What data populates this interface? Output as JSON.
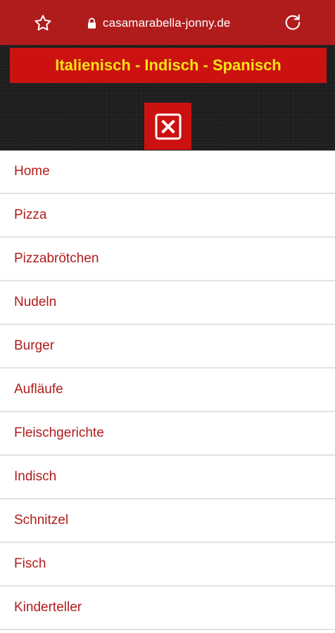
{
  "browser": {
    "url": "casamarabella-jonny.de",
    "icons": [
      "star-icon",
      "lock-icon",
      "reload-icon"
    ]
  },
  "header": {
    "banner_text": "Italienisch - Indisch - Spanisch",
    "close_icon": "close-icon"
  },
  "colors": {
    "brand_red": "#cc1111",
    "browser_red": "#b01c1c",
    "banner_text": "#f6e312",
    "menu_text": "#b01c1c",
    "dark_band": "#1f1f1f"
  },
  "menu": {
    "items": [
      {
        "label": "Home"
      },
      {
        "label": "Pizza"
      },
      {
        "label": "Pizzabrötchen"
      },
      {
        "label": "Nudeln"
      },
      {
        "label": "Burger"
      },
      {
        "label": "Aufläufe"
      },
      {
        "label": "Fleischgerichte"
      },
      {
        "label": "Indisch"
      },
      {
        "label": "Schnitzel"
      },
      {
        "label": "Fisch"
      },
      {
        "label": "Kinderteller"
      }
    ]
  }
}
